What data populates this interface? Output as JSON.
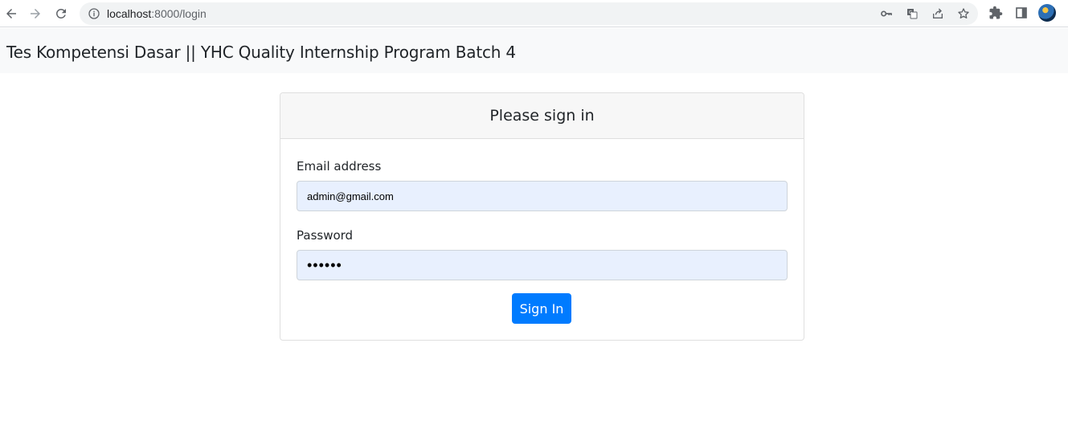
{
  "browser": {
    "url_host": "localhost",
    "url_rest": ":8000/login",
    "icons": {
      "back": "back-arrow-icon",
      "forward": "forward-arrow-icon",
      "reload": "reload-icon",
      "info": "info-icon",
      "key": "key-icon",
      "translate": "translate-icon",
      "share": "share-icon",
      "bookmark": "star-icon",
      "extensions": "puzzle-icon",
      "side_panel": "side-panel-icon"
    }
  },
  "navbar": {
    "brand": "Tes Kompetensi Dasar || YHC Quality Internship Program Batch 4"
  },
  "login": {
    "title": "Please sign in",
    "email_label": "Email address",
    "email_value": "admin@gmail.com",
    "password_label": "Password",
    "password_value": "••••••",
    "submit_label": "Sign In"
  },
  "colors": {
    "primary": "#007bff",
    "autofill_bg": "#e8f0fe",
    "navbar_bg": "#f8f9fa"
  }
}
